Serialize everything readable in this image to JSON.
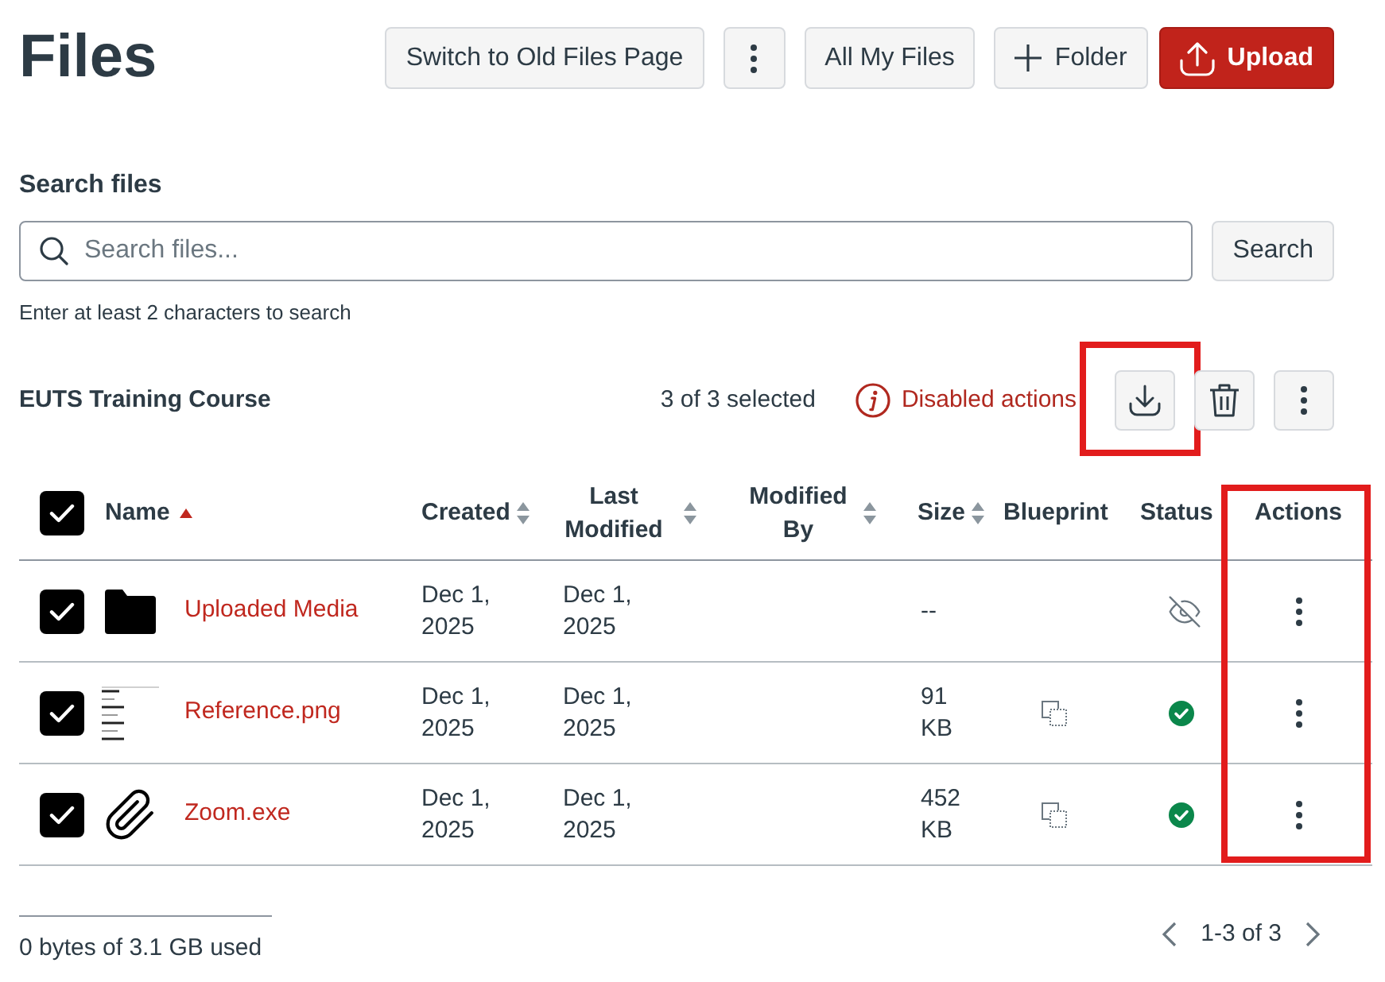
{
  "page": {
    "title": "Files"
  },
  "header_buttons": [
    {
      "kind": "switch",
      "label": "Switch to Old Files Page",
      "primary": false
    },
    {
      "kind": "more",
      "primary": false
    },
    {
      "kind": "files",
      "label": "All My Files",
      "primary": false
    },
    {
      "kind": "add",
      "label": "Folder",
      "primary": false
    },
    {
      "kind": "upload",
      "label": "Upload",
      "primary": true
    }
  ],
  "search": {
    "label": "Search files",
    "placeholder": "Search files...",
    "button": "Search",
    "hint": "Enter at least 2 characters to search"
  },
  "toolbar": {
    "context": "EUTS Training Course",
    "selection": "3 of 3 selected",
    "notice": "Disabled actions",
    "actions": [
      {
        "kind": "download",
        "highlighted": true
      },
      {
        "kind": "delete",
        "highlighted": false
      },
      {
        "kind": "more",
        "highlighted": false
      }
    ]
  },
  "table": {
    "select_all": {
      "checked": true
    },
    "columns": [
      {
        "label": "Name",
        "sortable": true,
        "sorted": true,
        "highlighted": false
      },
      {
        "label": "Created",
        "sortable": true,
        "sorted": false,
        "highlighted": false
      },
      {
        "label": "Last Modified",
        "sortable": true,
        "sorted": false,
        "highlighted": false
      },
      {
        "label": "Modified By",
        "sortable": true,
        "sorted": false,
        "highlighted": false
      },
      {
        "label": "Size",
        "sortable": true,
        "sorted": false,
        "highlighted": false
      },
      {
        "label": "Blueprint",
        "sortable": false,
        "sorted": false,
        "highlighted": false
      },
      {
        "label": "Status",
        "sortable": false,
        "sorted": false,
        "highlighted": false
      },
      {
        "label": "Actions",
        "sortable": false,
        "sorted": false,
        "highlighted": true
      }
    ],
    "rows": [
      {
        "selected": true,
        "kind": "folder",
        "name": "Uploaded Media",
        "created": "Dec 1, 2025",
        "last_modified": "Dec 1, 2025",
        "size": "--",
        "blueprint": false,
        "published": false
      },
      {
        "selected": true,
        "kind": "image",
        "name": "Reference.png",
        "created": "Dec 1, 2025",
        "last_modified": "Dec 1, 2025",
        "size": "91 KB",
        "blueprint": true,
        "published": true
      },
      {
        "selected": true,
        "kind": "file",
        "name": "Zoom.exe",
        "created": "Dec 1, 2025",
        "last_modified": "Dec 1, 2025",
        "size": "452 KB",
        "blueprint": true,
        "published": true
      }
    ]
  },
  "footer": {
    "usage": "0 bytes of 3.1 GB used",
    "pagination": "1-3 of 3"
  }
}
